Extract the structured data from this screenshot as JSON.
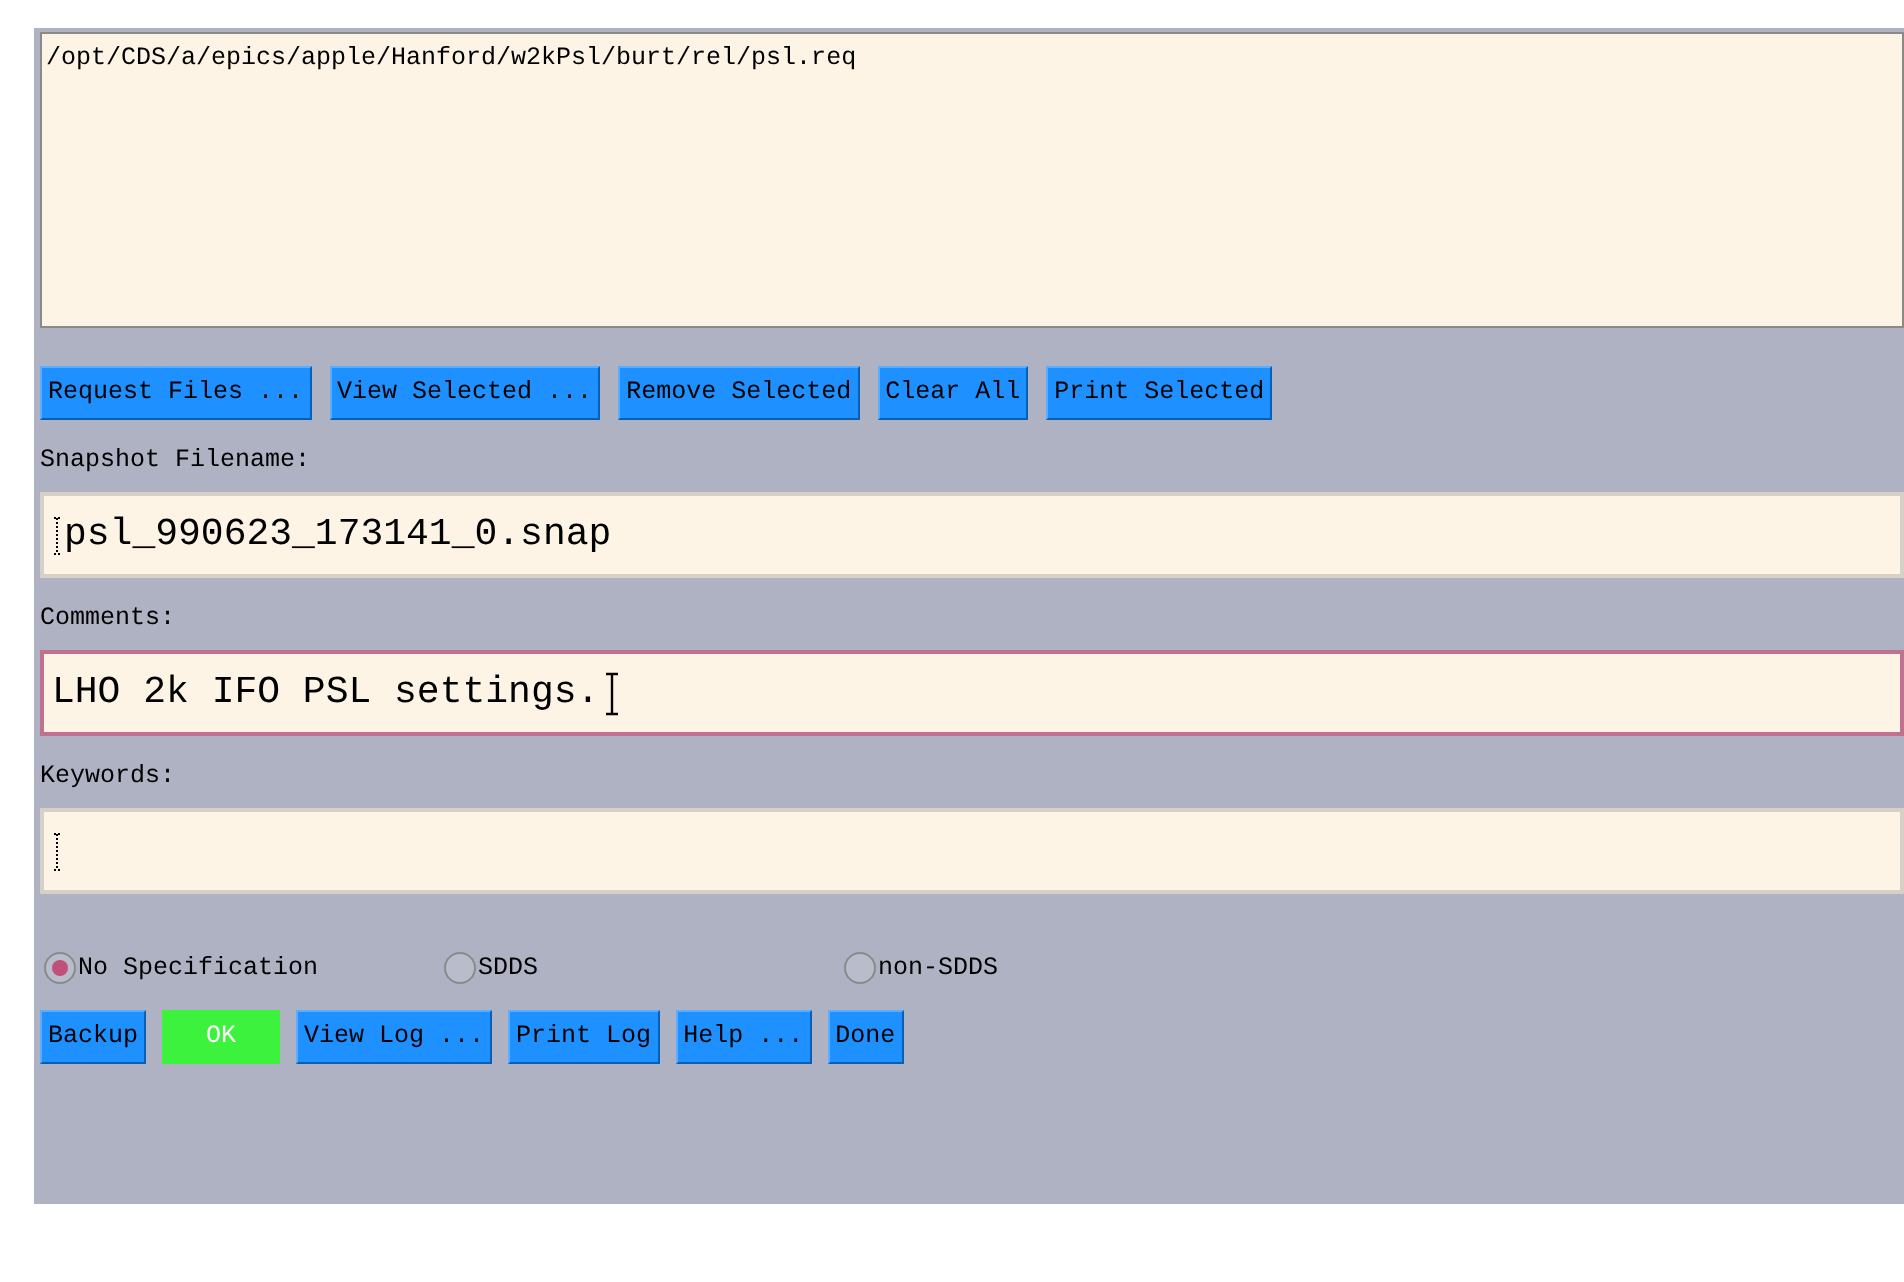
{
  "file_list": {
    "items": [
      "/opt/CDS/a/epics/apple/Hanford/w2kPsl/burt/rel/psl.req"
    ]
  },
  "file_buttons": [
    {
      "label": "Request Files ...",
      "kind": "normal"
    },
    {
      "label": "View Selected ...",
      "kind": "normal"
    },
    {
      "label": "Remove Selected",
      "kind": "normal"
    },
    {
      "label": "Clear All",
      "kind": "normal"
    },
    {
      "label": "Print Selected",
      "kind": "normal"
    }
  ],
  "fields": [
    {
      "label": "Snapshot Filename:",
      "value": "psl_990623_173141_0.snap",
      "focused": false,
      "insertion_cursor": false
    },
    {
      "label": "Comments:",
      "value": "LHO 2k IFO PSL settings.",
      "focused": true,
      "insertion_cursor": true
    },
    {
      "label": "Keywords:",
      "focused": false,
      "insertion_cursor": false
    }
  ],
  "format_options": [
    {
      "label": "No Specification",
      "selected": true
    },
    {
      "label": "SDDS",
      "selected": false
    },
    {
      "label": "non-SDDS",
      "selected": false
    }
  ],
  "action_buttons": [
    {
      "label": "Backup",
      "kind": "normal"
    },
    {
      "label": "OK",
      "kind": "default"
    },
    {
      "label": "View Log ...",
      "kind": "normal"
    },
    {
      "label": "Print Log",
      "kind": "normal"
    },
    {
      "label": "Help ...",
      "kind": "normal"
    },
    {
      "label": "Done",
      "kind": "normal"
    }
  ]
}
